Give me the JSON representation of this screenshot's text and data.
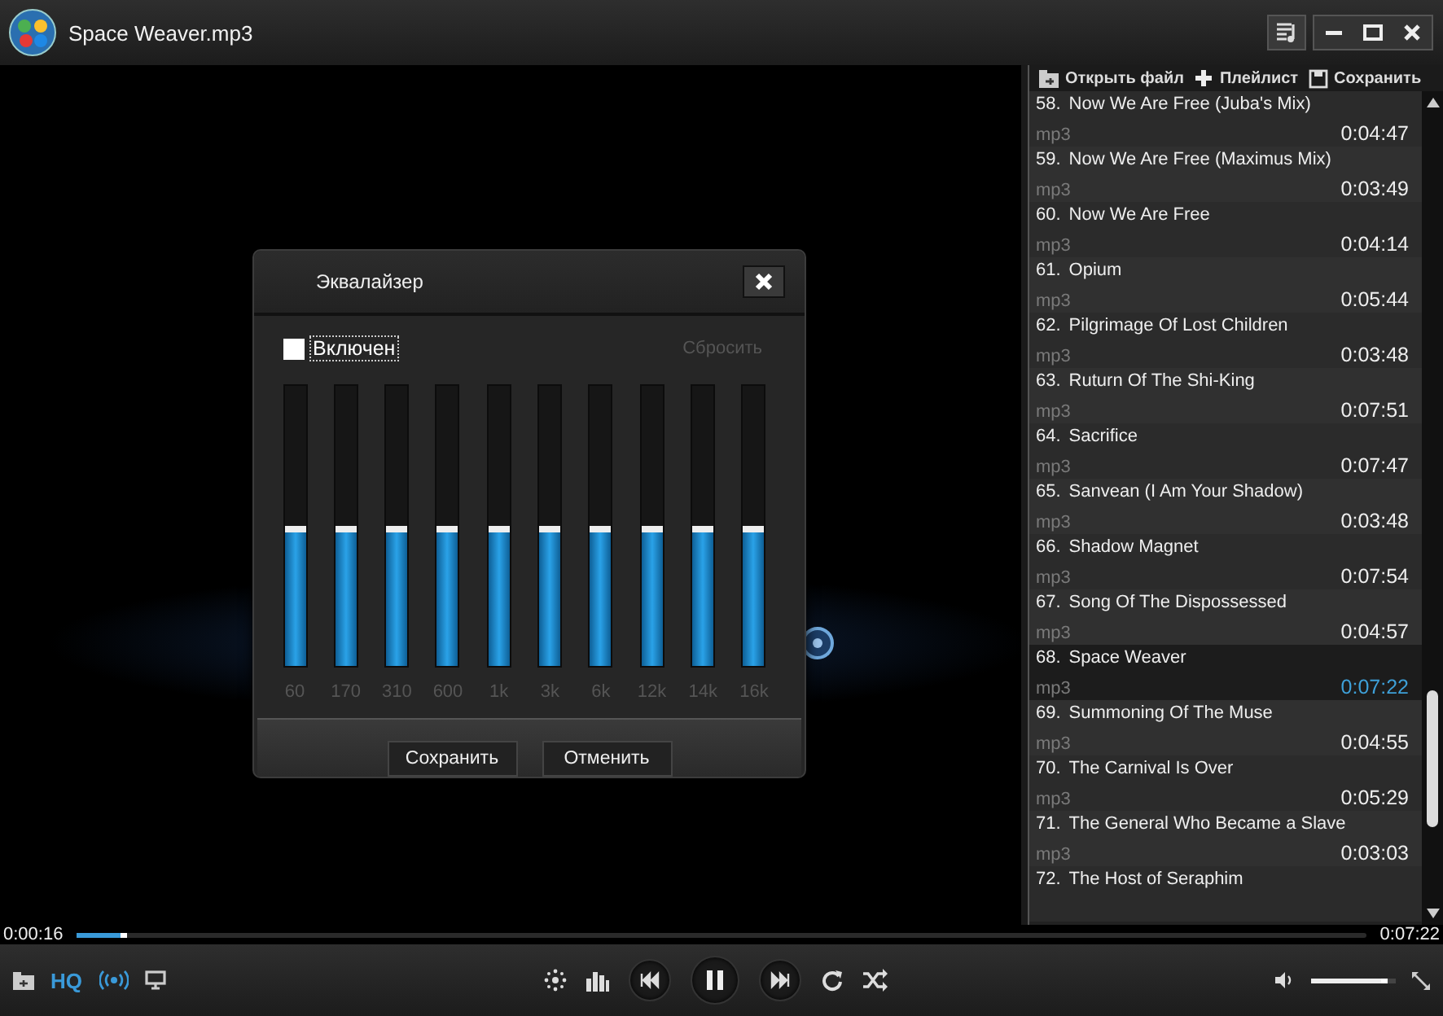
{
  "window": {
    "title": "Space Weaver.mp3"
  },
  "playlist_toolbar": [
    {
      "kind": "open",
      "label": "Открыть файл"
    },
    {
      "kind": "add",
      "label": "Плейлист"
    },
    {
      "kind": "save",
      "label": "Сохранить"
    }
  ],
  "playlist": [
    {
      "number": "58.",
      "title": "Now We Are Free (Juba's Mix)",
      "format": "mp3",
      "duration": "0:04:47",
      "selected": false
    },
    {
      "number": "59.",
      "title": "Now We Are Free (Maximus Mix)",
      "format": "mp3",
      "duration": "0:03:49",
      "selected": false
    },
    {
      "number": "60.",
      "title": "Now We Are Free",
      "format": "mp3",
      "duration": "0:04:14",
      "selected": false
    },
    {
      "number": "61.",
      "title": "Opium",
      "format": "mp3",
      "duration": "0:05:44",
      "selected": false
    },
    {
      "number": "62.",
      "title": "Pilgrimage Of Lost Children",
      "format": "mp3",
      "duration": "0:03:48",
      "selected": false
    },
    {
      "number": "63.",
      "title": "Ruturn Of The Shi-King",
      "format": "mp3",
      "duration": "0:07:51",
      "selected": false
    },
    {
      "number": "64.",
      "title": "Sacrifice",
      "format": "mp3",
      "duration": "0:07:47",
      "selected": false
    },
    {
      "number": "65.",
      "title": "Sanvean (I Am Your Shadow)",
      "format": "mp3",
      "duration": "0:03:48",
      "selected": false
    },
    {
      "number": "66.",
      "title": "Shadow Magnet",
      "format": "mp3",
      "duration": "0:07:54",
      "selected": false
    },
    {
      "number": "67.",
      "title": "Song Of The Dispossessed",
      "format": "mp3",
      "duration": "0:04:57",
      "selected": false
    },
    {
      "number": "68.",
      "title": "Space Weaver",
      "format": "mp3",
      "duration": "0:07:22",
      "selected": true
    },
    {
      "number": "69.",
      "title": "Summoning Of The Muse",
      "format": "mp3",
      "duration": "0:04:55",
      "selected": false
    },
    {
      "number": "70.",
      "title": "The Carnival Is Over",
      "format": "mp3",
      "duration": "0:05:29",
      "selected": false
    },
    {
      "number": "71.",
      "title": "The General Who Became a Slave",
      "format": "mp3",
      "duration": "0:03:03",
      "selected": false
    },
    {
      "number": "72.",
      "title": "The Host of Seraphim"
    }
  ],
  "equalizer": {
    "title": "Эквалайзер",
    "enabled": {
      "label": "Включен",
      "checked": false
    },
    "reset": {
      "label": "Сбросить",
      "disabled": true
    },
    "bands": [
      {
        "label": "60",
        "level": 0.5
      },
      {
        "label": "170",
        "level": 0.5
      },
      {
        "label": "310",
        "level": 0.5
      },
      {
        "label": "600",
        "level": 0.5
      },
      {
        "label": "1k",
        "level": 0.5
      },
      {
        "label": "3k",
        "level": 0.5
      },
      {
        "label": "6k",
        "level": 0.5
      },
      {
        "label": "12k",
        "level": 0.5
      },
      {
        "label": "14k",
        "level": 0.5
      },
      {
        "label": "16k",
        "level": 0.5
      }
    ],
    "buttons": [
      "Сохранить",
      "Отменить"
    ]
  },
  "progress": {
    "elapsed": "0:00:16",
    "total": "0:07:22",
    "level": 0.04
  },
  "controls": {
    "hq": {
      "label": "HQ",
      "on": true
    },
    "broadcast": {
      "on": true
    },
    "volume": {
      "level": 0.9
    }
  }
}
